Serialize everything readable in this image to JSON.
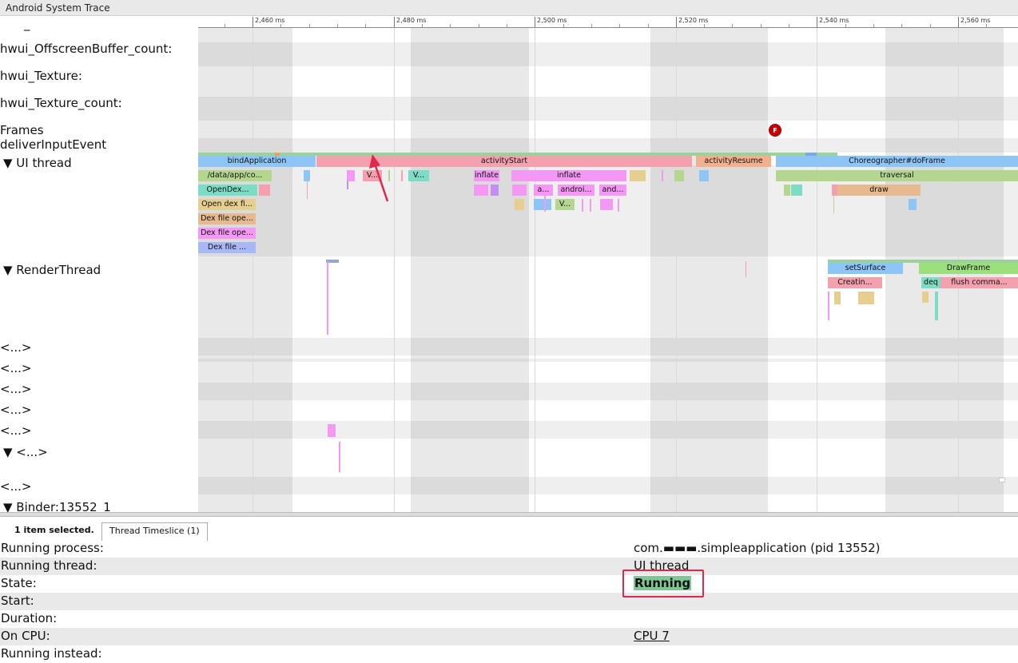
{
  "window": {
    "title": "Android System Trace"
  },
  "ruler": {
    "ticks": [
      {
        "label": "2,460 ms"
      },
      {
        "label": "2,480 ms"
      },
      {
        "label": "2,500 ms"
      },
      {
        "label": "2,520 ms"
      },
      {
        "label": "2,540 ms"
      },
      {
        "label": "2,560 ms"
      }
    ]
  },
  "tracks": {
    "dash": "_",
    "offscreen_buffer_count": "hwui_OffscreenBuffer_count:",
    "texture": "hwui_Texture:",
    "texture_count": "hwui_Texture_count:",
    "frames": "Frames",
    "deliver_input": "deliverInputEvent",
    "ui_thread": "▼  UI thread",
    "render_thread": "▼  RenderThread",
    "unknown1": "<...>",
    "unknown2": "<...>",
    "unknown3": "<...>",
    "unknown4": "<...>",
    "unknown5": "<...>",
    "unknown_expanded": "▼  <...>",
    "unknown6": "<...>",
    "binder": "▼  Binder:13552_1"
  },
  "frame_marker": "F",
  "slices": {
    "bind_application": "bindApplication",
    "activity_start": "activityStart",
    "activity_resume": "activityResume",
    "choreographer": "Choreographer#doFrame",
    "data_app": "/data/app/co...",
    "v1": "V...",
    "v2": "V...",
    "inflate1": "inflate",
    "inflate2": "inflate",
    "traversal": "traversal",
    "open_dex1": "OpenDex...",
    "a_short": "a...",
    "android_short": "androi...",
    "and_short": "and...",
    "draw": "draw",
    "open_dex_file": "Open dex fi...",
    "v3": "V...",
    "dex_file_ope1": "Dex file ope...",
    "dex_file_ope2": "Dex file ope...",
    "dex_file": "Dex file ...",
    "set_surface": "setSurface",
    "draw_frame": "DrawFrame",
    "creating": "Creatin...",
    "deq": "deq",
    "flush_commands": "flush comma..."
  },
  "selection": {
    "count_text": "1 item selected.",
    "tab_label": "Thread Timeslice (1)"
  },
  "details": {
    "running_process_label": "Running process:",
    "running_process_value": "com.▬▬▬.simpleapplication (pid 13552)",
    "running_thread_label": "Running thread:",
    "running_thread_value": "UI thread",
    "state_label": "State:",
    "state_value": "Running",
    "start_label": "Start:",
    "duration_label": "Duration:",
    "on_cpu_label": "On CPU:",
    "on_cpu_value": "CPU 7",
    "running_instead_label": "Running instead:"
  },
  "colors": {
    "bind_application": "#8ec5f7",
    "activity_start": "#f4a0ae",
    "activity_resume": "#f2b08f",
    "choreographer": "#8ec5f7",
    "traversal": "#b5d68e",
    "draw": "#e6b98e",
    "state_running": "#7fc796",
    "annotation_red": "#e0294a"
  }
}
